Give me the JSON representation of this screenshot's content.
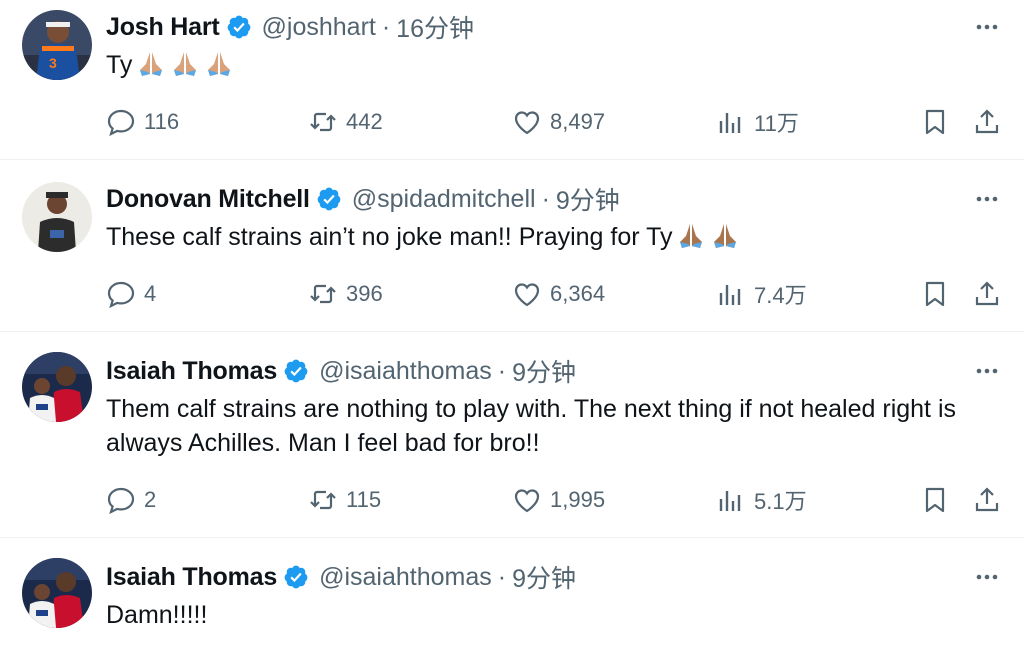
{
  "tweets": [
    {
      "name": "Josh Hart",
      "handle": "@joshhart",
      "sep": "·",
      "time": "16分钟",
      "text": "Ty",
      "emoji_count": 3,
      "replies": "116",
      "retweets": "442",
      "likes": "8,497",
      "views": "11万"
    },
    {
      "name": "Donovan Mitchell",
      "handle": "@spidadmitchell",
      "sep": "·",
      "time": "9分钟",
      "text": "These calf strains ain’t no joke man!! Praying for Ty",
      "emoji_count": 2,
      "replies": "4",
      "retweets": "396",
      "likes": "6,364",
      "views": "7.4万"
    },
    {
      "name": "Isaiah Thomas",
      "handle": "@isaiahthomas",
      "sep": "·",
      "time": "9分钟",
      "text": "Them calf strains are nothing to play with. The next thing if not healed right is always Achilles. Man I feel bad for bro!!",
      "emoji_count": 0,
      "replies": "2",
      "retweets": "115",
      "likes": "1,995",
      "views": "5.1万"
    },
    {
      "name": "Isaiah Thomas",
      "handle": "@isaiahthomas",
      "sep": "·",
      "time": "9分钟",
      "text": "Damn!!!!!",
      "emoji_count": 0
    }
  ],
  "colors": {
    "text": "#0f1419",
    "muted": "#536471",
    "verified": "#1d9bf0",
    "divider": "#eff3f4"
  },
  "icons": {
    "reply": "reply-icon",
    "retweet": "retweet-icon",
    "like": "heart-icon",
    "views": "views-icon",
    "bookmark": "bookmark-icon",
    "share": "share-icon",
    "more": "more-icon",
    "verified": "verified-badge-icon",
    "emoji": "folded-hands-emoji"
  }
}
